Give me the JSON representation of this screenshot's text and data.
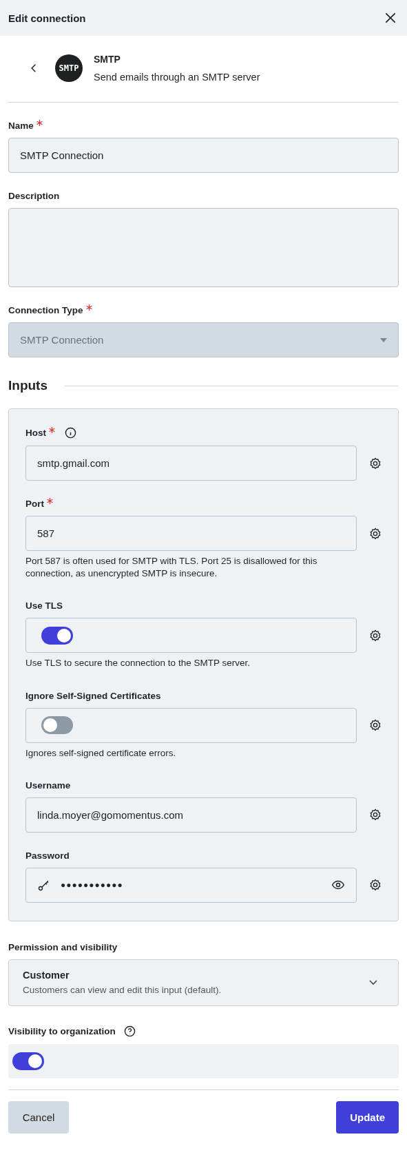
{
  "header": {
    "title": "Edit connection"
  },
  "connector": {
    "logo": "SMTP",
    "name": "SMTP",
    "description": "Send emails through an SMTP server"
  },
  "form": {
    "name": {
      "label": "Name",
      "required": true,
      "value": "SMTP Connection"
    },
    "description": {
      "label": "Description",
      "required": false
    },
    "connection_type": {
      "label": "Connection Type",
      "required": true,
      "value": "SMTP Connection",
      "disabled": true
    }
  },
  "inputs": {
    "title": "Inputs",
    "fields": [
      {
        "kind": "text",
        "label": "Host",
        "required": true,
        "info": true,
        "value": "smtp.gmail.com"
      },
      {
        "kind": "text",
        "label": "Port",
        "required": true,
        "info": false,
        "value": "587",
        "help": "Port 587 is often used for SMTP with TLS. Port 25 is disallowed for this connection, as unencrypted SMTP is insecure."
      },
      {
        "kind": "toggle",
        "label": "Use TLS",
        "required": false,
        "info": false,
        "on": true,
        "help": "Use TLS to secure the connection to the SMTP server."
      },
      {
        "kind": "toggle",
        "label": "Ignore Self-Signed Certificates",
        "required": false,
        "info": false,
        "on": false,
        "help": "Ignores self-signed certificate errors."
      },
      {
        "kind": "text",
        "label": "Username",
        "required": false,
        "info": false,
        "value": "linda.moyer@gomomentus.com"
      },
      {
        "kind": "password",
        "label": "Password",
        "required": false,
        "info": false,
        "value": "●●●●●●●●●●●"
      }
    ]
  },
  "permission": {
    "label": "Permission and visibility",
    "title": "Customer",
    "description": "Customers can view and edit this input (default)."
  },
  "visibility": {
    "label": "Visibility to organization",
    "on": true
  },
  "buttons": [
    {
      "kind": "secondary",
      "label": "Cancel"
    },
    {
      "kind": "primary",
      "label": "Update"
    }
  ]
}
